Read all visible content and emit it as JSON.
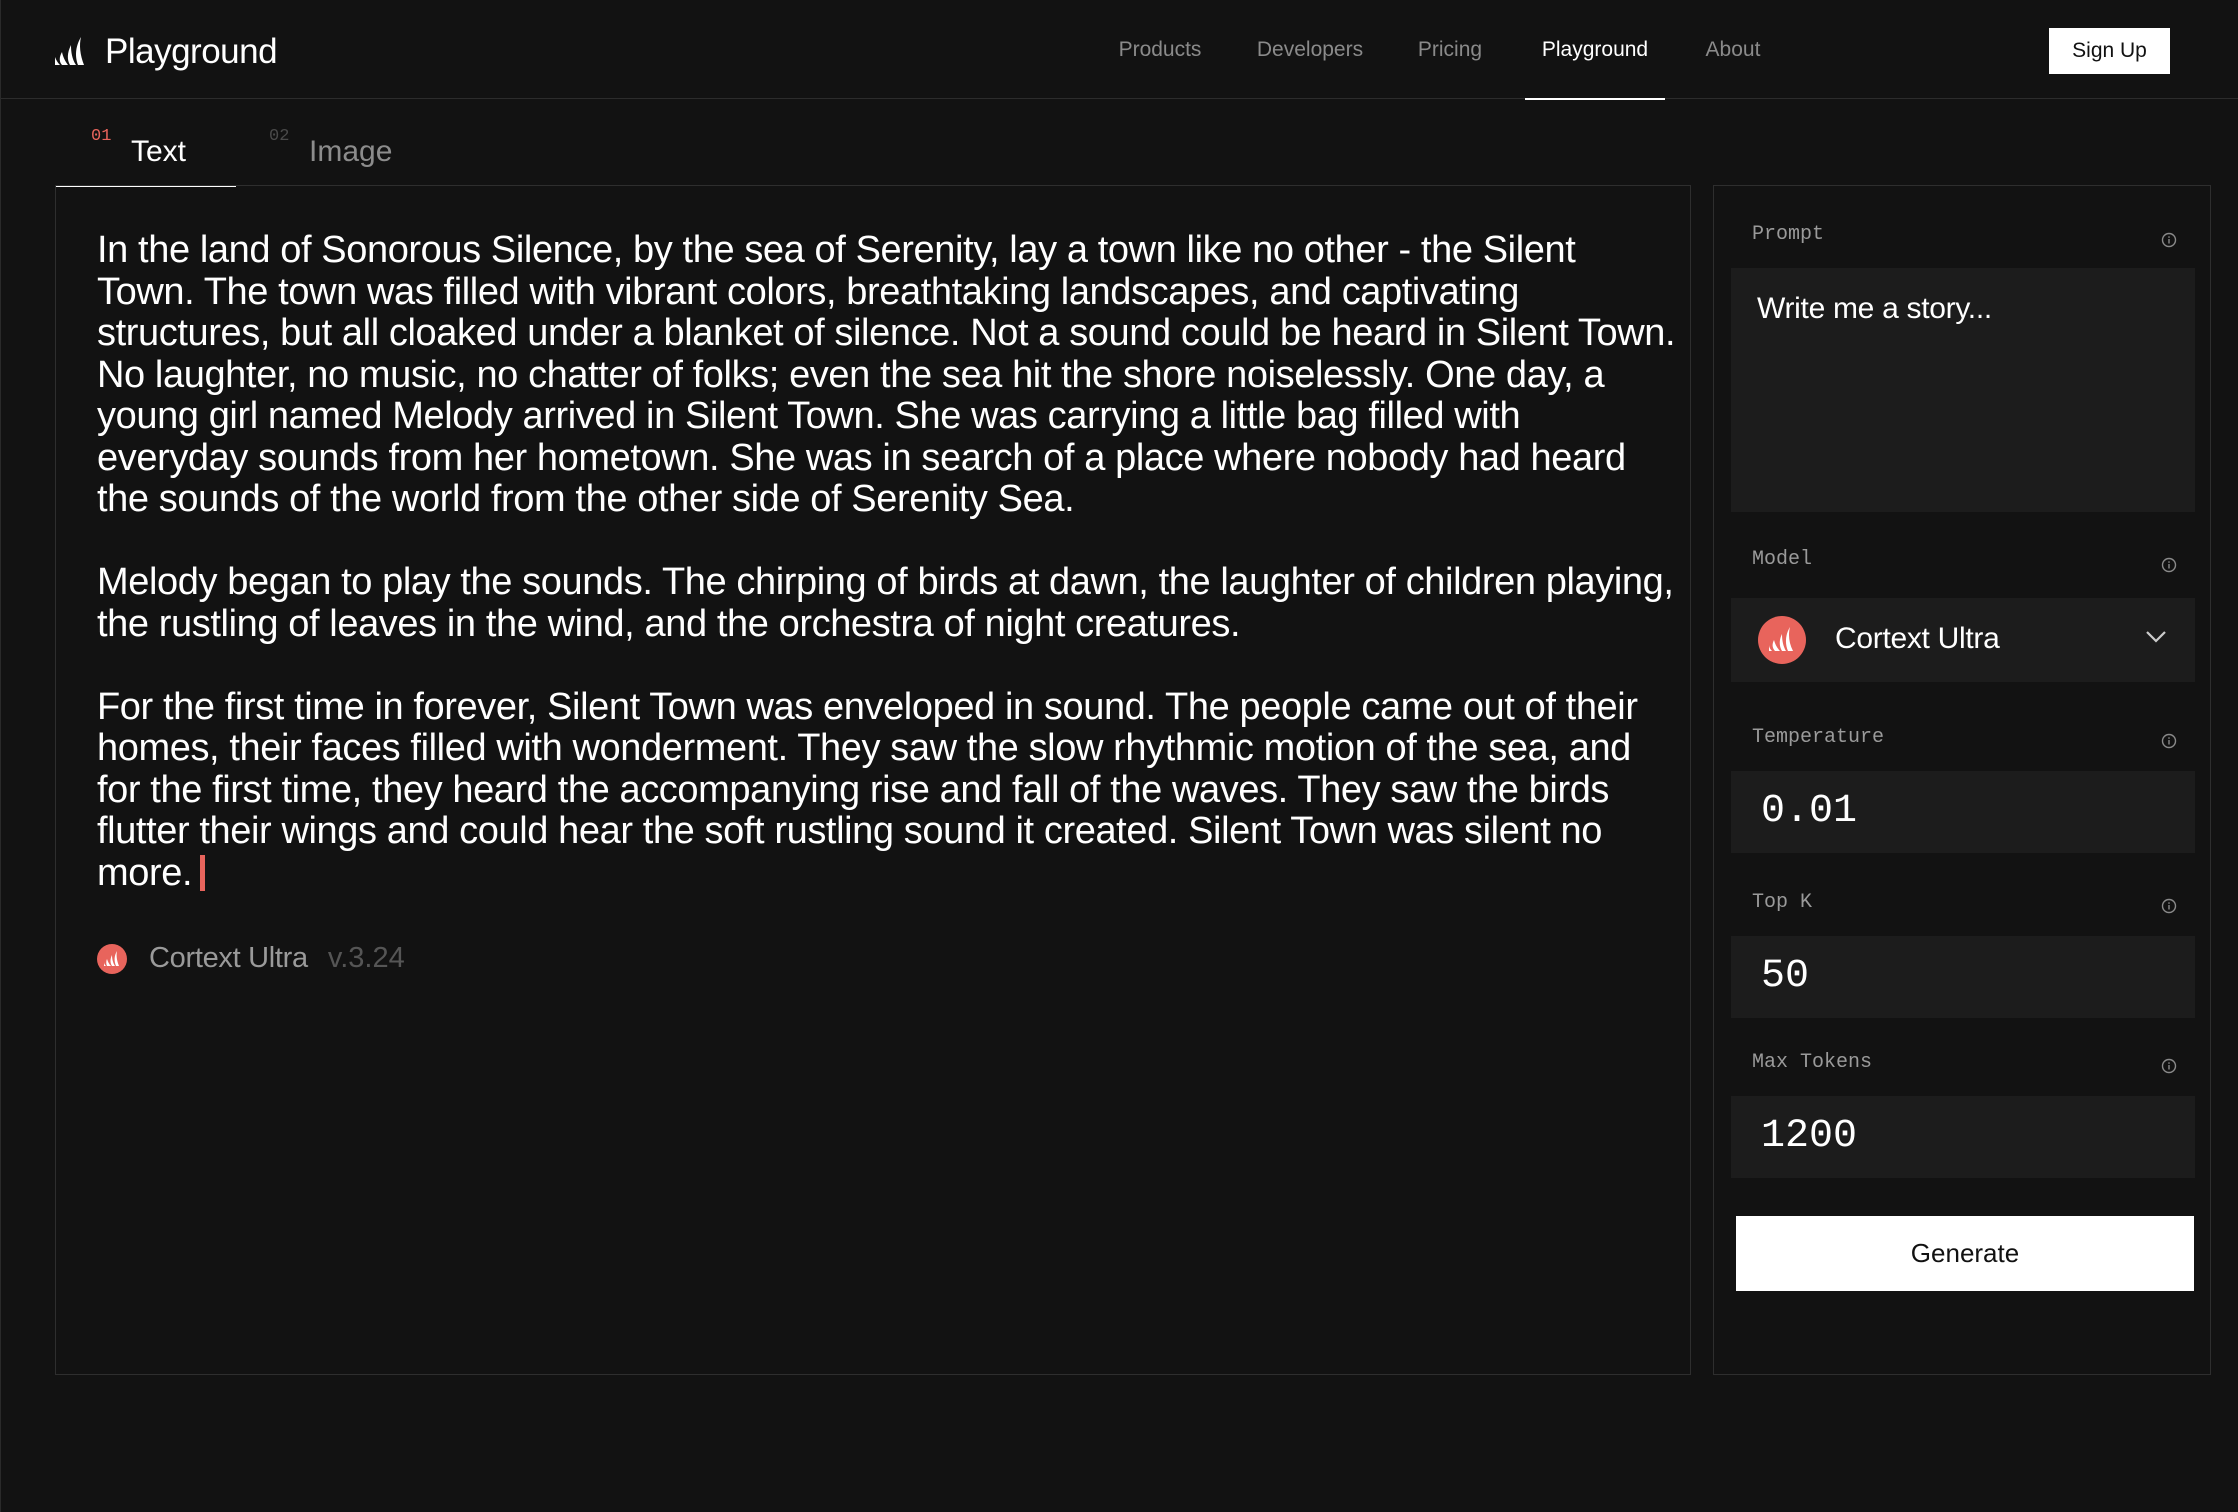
{
  "header": {
    "brand": "Playground",
    "nav": [
      {
        "label": "Products",
        "active": false
      },
      {
        "label": "Developers",
        "active": false
      },
      {
        "label": "Pricing",
        "active": false
      },
      {
        "label": "Playground",
        "active": true
      },
      {
        "label": "About",
        "active": false
      }
    ],
    "signup_label": "Sign Up"
  },
  "tabs": [
    {
      "num": "01",
      "label": "Text",
      "active": true
    },
    {
      "num": "02",
      "label": "Image",
      "active": false
    }
  ],
  "output": {
    "paragraphs": [
      "In the land of Sonorous Silence, by the sea of Serenity, lay a town like no other - the Silent Town. The town was filled with vibrant colors, breathtaking landscapes, and captivating structures, but all cloaked under a blanket of silence. Not a sound could be heard in Silent Town. No laughter, no music, no chatter of folks; even the sea hit the shore noiselessly. One day, a young girl named Melody arrived in Silent Town. She was carrying a little bag filled with everyday sounds from her hometown. She was in search of a place where nobody had heard the sounds of the world from the other side of Serenity Sea.",
      "Melody began to play the sounds. The chirping of birds at dawn, the laughter of children playing, the rustling of leaves in the wind, and the orchestra of night creatures.",
      "For the first time in forever, Silent Town was enveloped in sound. The people came out of their homes, their faces filled with wonderment. They saw the slow rhythmic motion of the sea, and for the first time, they heard the accompanying rise and fall of the waves. They saw the birds flutter their wings and could hear the soft rustling sound it created. Silent Town was silent no more."
    ],
    "model_name": "Cortext Ultra",
    "model_version": "v.3.24"
  },
  "settings": {
    "prompt_label": "Prompt",
    "prompt_value": "Write me a story...",
    "model_label": "Model",
    "model_value": "Cortext Ultra",
    "temperature_label": "Temperature",
    "temperature_value": "0.01",
    "topk_label": "Top K",
    "topk_value": "50",
    "maxtokens_label": "Max Tokens",
    "maxtokens_value": "1200",
    "generate_label": "Generate"
  },
  "colors": {
    "accent": "#e8645c",
    "background": "#121212",
    "field": "#1c1c1c",
    "border": "#2e2e2e"
  },
  "icons": [
    "brand-logo-icon",
    "model-logo-icon",
    "info-icon",
    "chevron-down-icon"
  ]
}
